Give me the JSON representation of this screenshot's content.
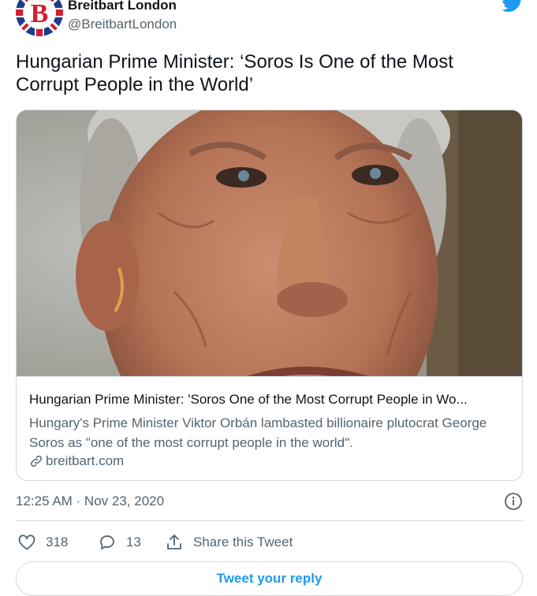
{
  "author": {
    "name": "Breitbart London",
    "handle": "@BreitbartLondon",
    "logo_letter": "B",
    "icon": "union-jack-b-avatar"
  },
  "brand_icon": "twitter-bird-icon",
  "tweet": {
    "text": "Hungarian Prime Minister: ‘Soros Is One of the Most Corrupt People in the World’"
  },
  "card": {
    "image_description_icon": "portrait-photo",
    "title": "Hungarian Prime Minister: 'Soros One of the Most Corrupt People in Wo...",
    "description": "Hungary's Prime Minister Viktor Orbán lambasted billionaire plutocrat George Soros as \"one of the most corrupt people in the world\".",
    "domain": "breitbart.com",
    "domain_icon": "link-icon"
  },
  "meta": {
    "timestamp": "12:25 AM · Nov 23, 2020",
    "info_icon": "info-icon"
  },
  "actions": {
    "likes": "318",
    "replies": "13",
    "share_label": "Share this Tweet"
  },
  "reply_button": "Tweet your reply",
  "colors": {
    "accent": "#1d9bf0",
    "text": "#0f1419",
    "secondary": "#536471",
    "border": "#cfd9de"
  }
}
